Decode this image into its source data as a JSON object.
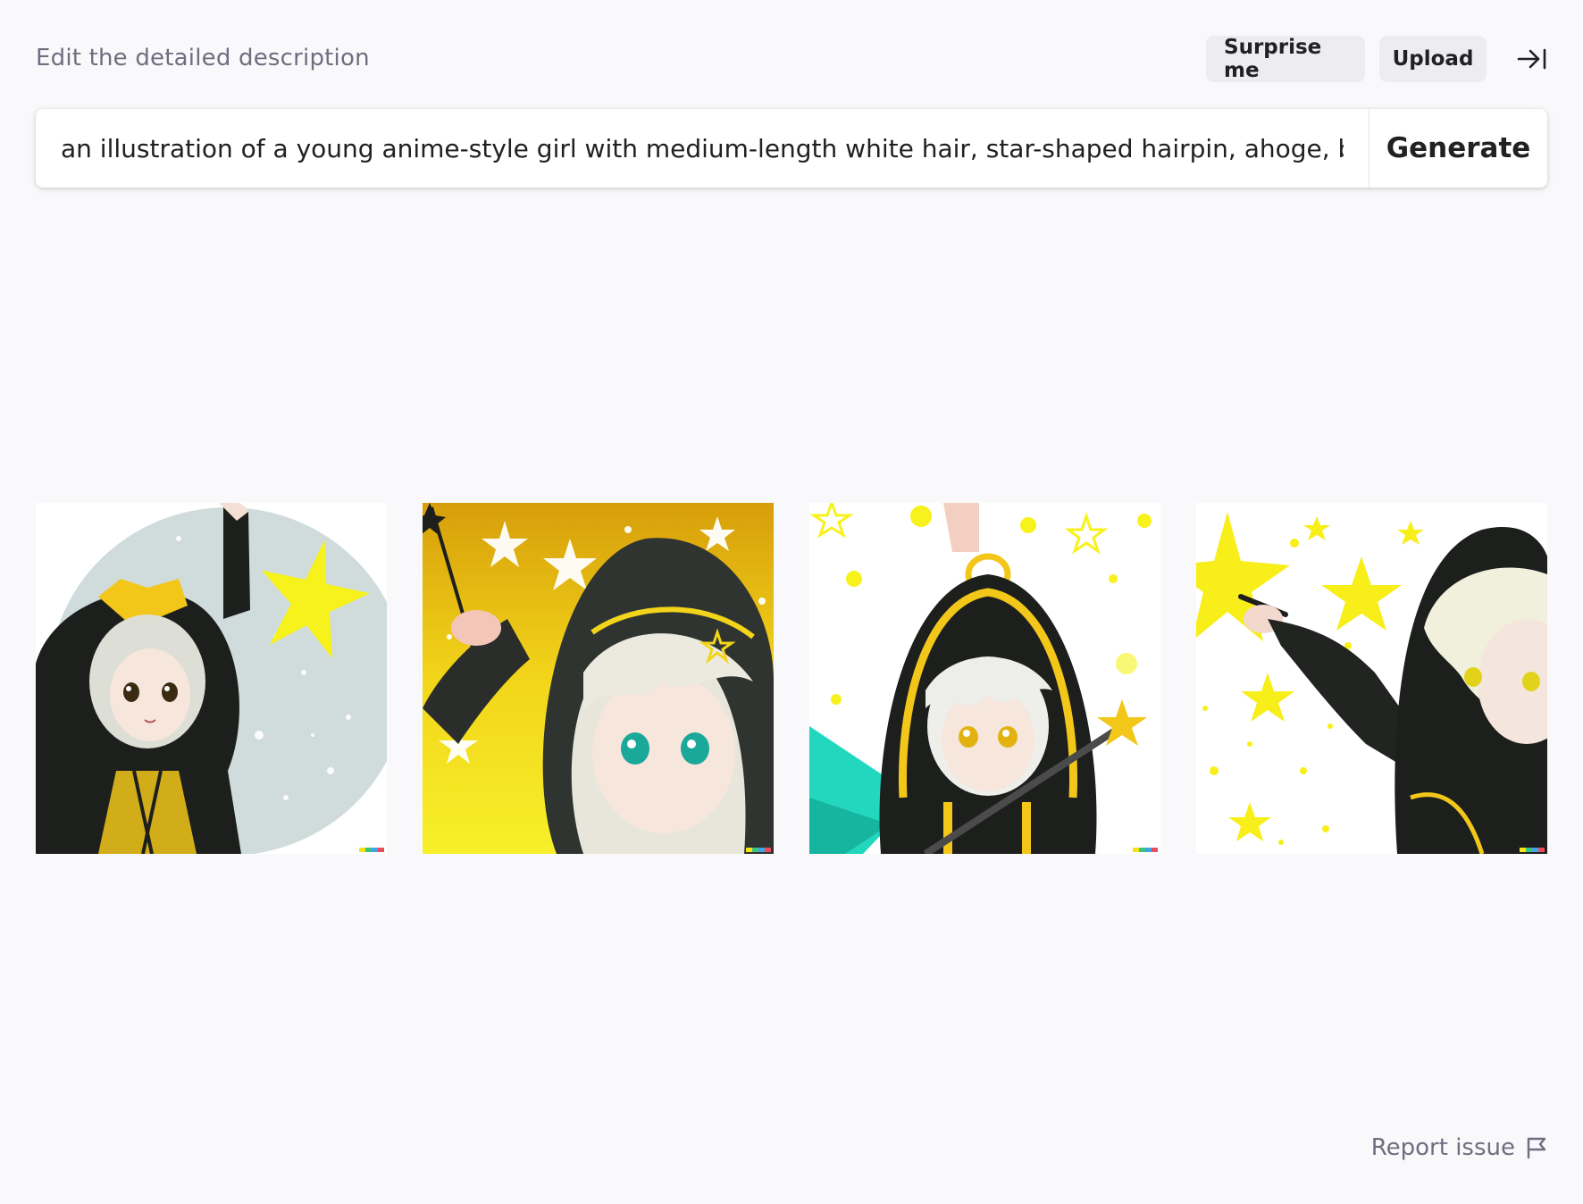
{
  "header": {
    "label": "Edit the detailed description",
    "surprise_label": "Surprise me",
    "upload_label": "Upload",
    "collapse_icon": "arrow-right-to-bar-icon"
  },
  "prompt": {
    "value": "an illustration of a young anime-style girl with medium-length white hair, star-shaped hairpin, ahoge, bright",
    "generate_label": "Generate"
  },
  "results": {
    "images": [
      {
        "name": "generated-image-1",
        "description_icon": "anime-girl-raising-hand-image"
      },
      {
        "name": "generated-image-2",
        "description_icon": "anime-girl-with-wand-image"
      },
      {
        "name": "generated-image-3",
        "description_icon": "anime-girl-in-hood-image"
      },
      {
        "name": "generated-image-4",
        "description_icon": "anime-girl-pointing-image"
      }
    ]
  },
  "footer": {
    "report_label": "Report issue",
    "report_icon": "flag-icon"
  },
  "colors": {
    "background": "#f9f9fb",
    "pill_background": "#ececf1",
    "muted_text": "#6e6e80",
    "star_yellow": "#f7e414",
    "hoodie_black": "#1d1f1d"
  }
}
